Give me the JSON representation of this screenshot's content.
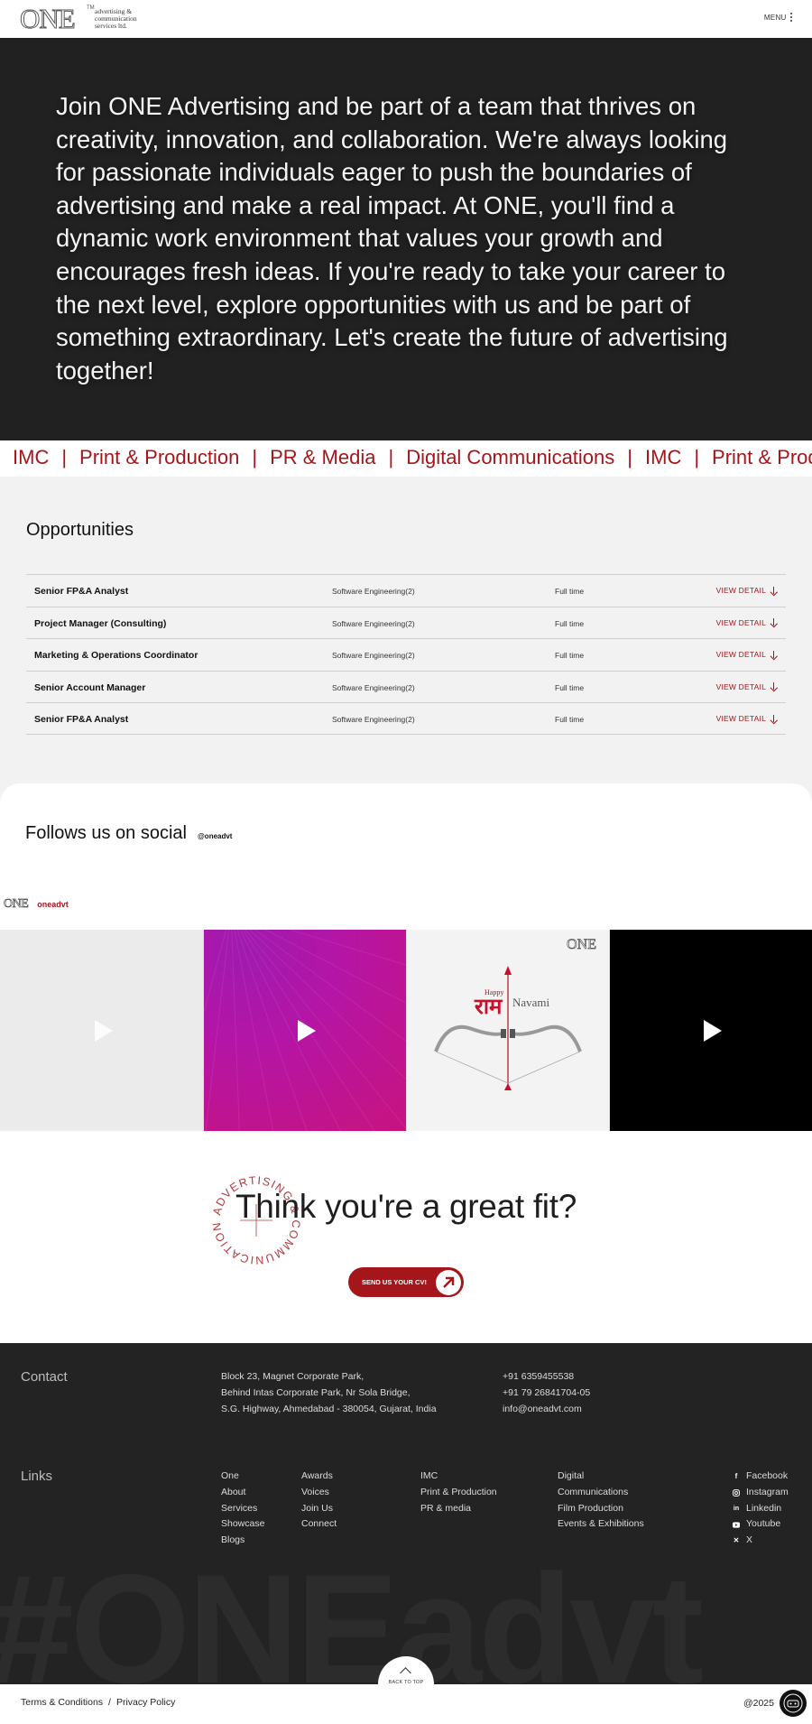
{
  "header": {
    "logo_text": "ONE",
    "logo_tm": "TM",
    "logo_tagline": "advertising &\ncommunication\nservices ltd.",
    "menu_label": "MENU"
  },
  "hero": {
    "text": "Join ONE Advertising and be part of a team that thrives on creativity, innovation, and collaboration. We're always looking for passionate individuals eager to push the boundaries of advertising and make a real impact. At ONE, you'll find a dynamic work environment that values your growth and encourages fresh ideas. If you're ready to take your career to the next level, explore opportunities with us and be part of something extraordinary. Let's create the future of advertising together!"
  },
  "marquee": {
    "items": [
      "IMC",
      "Print & Production",
      "PR & Media",
      "Digital Communications",
      "IMC",
      "Print & Production"
    ],
    "separator": "|"
  },
  "opportunities": {
    "title": "Opportunities",
    "jobs": [
      {
        "title": "Senior FP&A Analyst",
        "dept": "Software Engineering(2)",
        "type": "Full time",
        "action": "VIEW DETAIL"
      },
      {
        "title": "Project Manager (Consulting)",
        "dept": "Software Engineering(2)",
        "type": "Full time",
        "action": "VIEW DETAIL"
      },
      {
        "title": "Marketing & Operations Coordinator",
        "dept": "Software Engineering(2)",
        "type": "Full time",
        "action": "VIEW DETAIL"
      },
      {
        "title": "Senior Account Manager",
        "dept": "Software Engineering(2)",
        "type": "Full time",
        "action": "VIEW DETAIL"
      },
      {
        "title": "Senior FP&A Analyst",
        "dept": "Software Engineering(2)",
        "type": "Full time",
        "action": "VIEW DETAIL"
      }
    ]
  },
  "social": {
    "title": "Follows us on social",
    "handle": "@oneadvt",
    "feed_logo": "ONE",
    "feed_name": "oneadvt",
    "post3": {
      "brand": "ONE",
      "happy": "Happy",
      "ram": "राम",
      "navami": "Navami"
    }
  },
  "cta": {
    "title": "Think you're a great fit?",
    "badge_text": "ADVERTISING & COMMUNICATION",
    "button_label": "SEND US YOUR CV!"
  },
  "footer": {
    "contact_label": "Contact",
    "address": [
      "Block 23, Magnet Corporate Park,",
      "Behind Intas Corporate Park, Nr Sola Bridge,",
      "S.G. Highway, Ahmedabad - 380054, Gujarat, India"
    ],
    "phones": [
      "+91 6359455538",
      "+91 79 26841704-05",
      "info@oneadvt.com"
    ],
    "links_label": "Links",
    "links_col1": [
      "One",
      "About",
      "Services",
      "Showcase",
      "Blogs"
    ],
    "links_col2": [
      "Awards",
      "Voices",
      "Join Us",
      "Connect"
    ],
    "links_col3": [
      "IMC",
      "Print & Production",
      "PR & media"
    ],
    "links_col4": [
      "Digital",
      "Communications",
      "Film Production",
      "Events & Exhibitions"
    ],
    "socials": [
      {
        "label": "Facebook",
        "icon": "facebook-icon"
      },
      {
        "label": "Instagram",
        "icon": "instagram-icon"
      },
      {
        "label": "Linkedin",
        "icon": "linkedin-icon"
      },
      {
        "label": "Youtube",
        "icon": "youtube-icon"
      },
      {
        "label": "X",
        "icon": "x-icon"
      }
    ],
    "watermark": "#ONEadvt",
    "back_to_top": "BACK TO TOP",
    "terms": "Terms & Conditions",
    "link_sep": "/",
    "privacy": "Privacy Policy",
    "copyright": "@2025"
  },
  "colors": {
    "accent": "#a4161a",
    "dark": "#222121",
    "light_bg": "#f2f2f2"
  }
}
